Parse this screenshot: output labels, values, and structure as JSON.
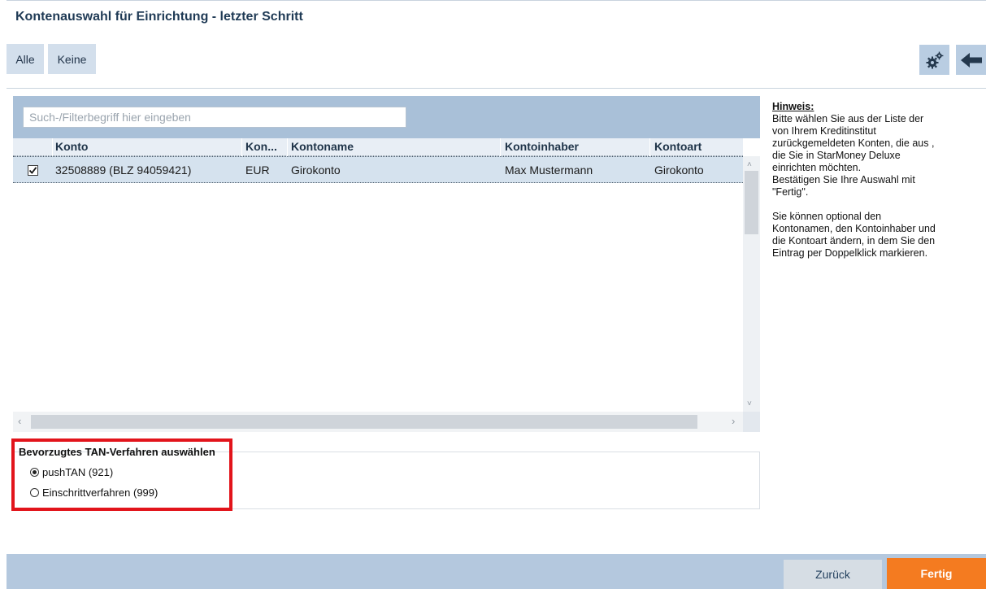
{
  "window": {
    "title": "Kontenauswahl für Einrichtung - letzter Schritt"
  },
  "toolbar": {
    "all_label": "Alle",
    "none_label": "Keine",
    "settings_icon": "gears-icon",
    "back_icon": "arrow-left-icon"
  },
  "search": {
    "placeholder": "Such-/Filterbegriff hier eingeben",
    "value": ""
  },
  "table": {
    "columns": [
      "Konto",
      "Kon...",
      "Kontoname",
      "Kontoinhaber",
      "Kontoart"
    ],
    "rows": [
      {
        "checked": true,
        "konto": "32508889 (BLZ 94059421)",
        "waehrung": "EUR",
        "kontoname": "Girokonto",
        "kontoinhaber": "Max Mustermann",
        "kontoart": "Girokonto"
      }
    ]
  },
  "tan": {
    "legend": "Bevorzugtes TAN-Verfahren auswählen",
    "options": [
      {
        "label": "pushTAN (921)",
        "selected": true
      },
      {
        "label": "Einschrittverfahren (999)",
        "selected": false
      }
    ]
  },
  "hint": {
    "title": "Hinweis:",
    "lines1": [
      "Bitte wählen Sie aus der Liste der",
      "von Ihrem  Kreditinstitut",
      "zurückgemeldeten Konten, die aus ,",
      "die Sie in StarMoney Deluxe",
      "einrichten möchten.",
      "Bestätigen Sie Ihre Auswahl mit",
      "\"Fertig\"."
    ],
    "lines2": [
      "Sie können optional den",
      "Kontonamen, den Kontoinhaber und",
      "die Kontoart ändern, in dem Sie den",
      "Eintrag per Doppelklick markieren."
    ]
  },
  "footer": {
    "back_label": "Zurück",
    "finish_label": "Fertig"
  },
  "colors": {
    "accent": "#f47b20",
    "highlight": "#e2141b",
    "panel": "#a9c0d8",
    "footer": "#b4c8de"
  }
}
